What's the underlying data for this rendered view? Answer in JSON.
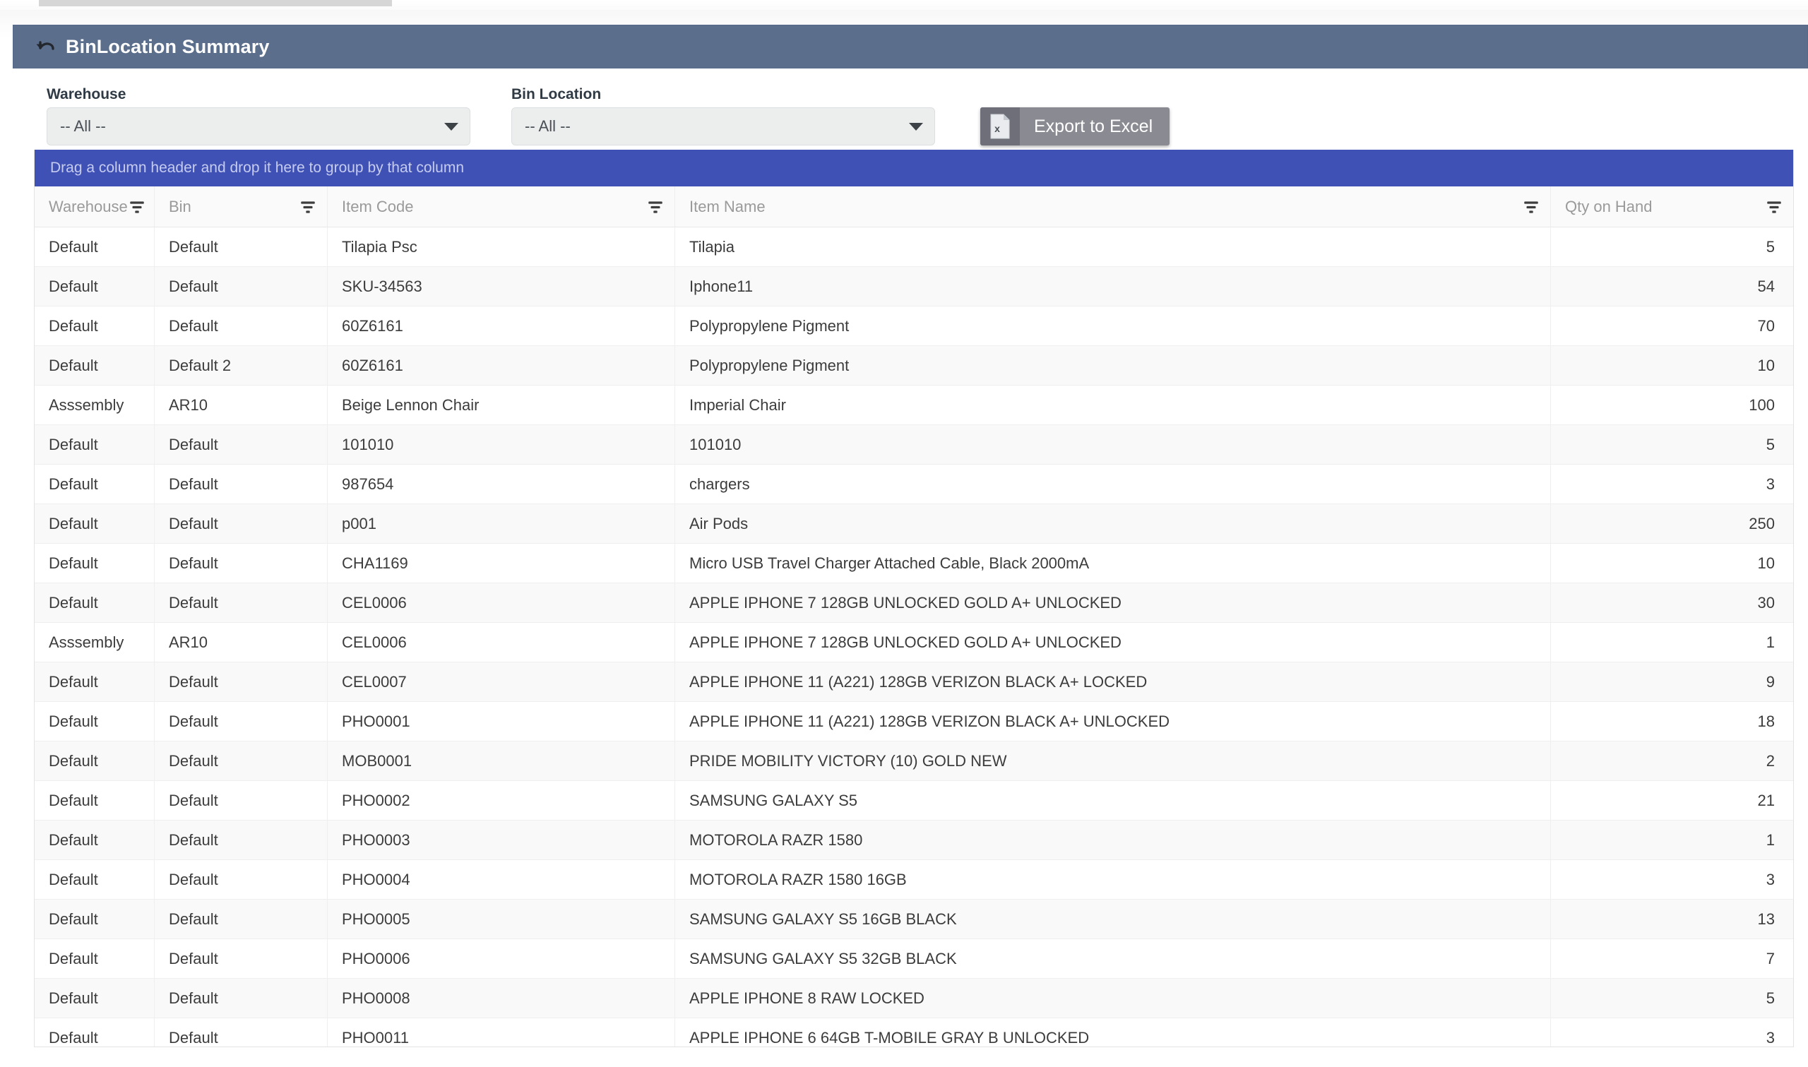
{
  "window": {
    "title": "BinLocation Summary",
    "back_icon": "undo-arrow-icon",
    "header_color": "#5b6e8c"
  },
  "filters": {
    "warehouse": {
      "label": "Warehouse",
      "value": "-- All --",
      "caret_icon": "chevron-down-icon"
    },
    "bin_location": {
      "label": "Bin Location",
      "value": "-- All --",
      "caret_icon": "chevron-down-icon"
    },
    "export_button": {
      "label": "Export to Excel",
      "icon": "excel-file-icon",
      "icon_glyph": "x",
      "color": "#8a8a93"
    }
  },
  "grid": {
    "group_panel_text": "Drag a column header and drop it here to group by that column",
    "group_panel_color": "#3f51b5",
    "filter_icon": "filter-icon",
    "columns": [
      {
        "key": "warehouse",
        "label": "Warehouse",
        "align": "left"
      },
      {
        "key": "bin",
        "label": "Bin",
        "align": "left"
      },
      {
        "key": "item_code",
        "label": "Item Code",
        "align": "left"
      },
      {
        "key": "item_name",
        "label": "Item Name",
        "align": "left"
      },
      {
        "key": "qty_on_hand",
        "label": "Qty on Hand",
        "align": "right"
      }
    ],
    "rows": [
      {
        "warehouse": "Default",
        "bin": "Default",
        "item_code": "Tilapia Psc",
        "item_name": "Tilapia",
        "qty_on_hand": "5"
      },
      {
        "warehouse": "Default",
        "bin": "Default",
        "item_code": "SKU-34563",
        "item_name": "Iphone11",
        "qty_on_hand": "54"
      },
      {
        "warehouse": "Default",
        "bin": "Default",
        "item_code": "60Z6161",
        "item_name": "Polypropylene Pigment",
        "qty_on_hand": "70"
      },
      {
        "warehouse": "Default",
        "bin": "Default 2",
        "item_code": "60Z6161",
        "item_name": "Polypropylene Pigment",
        "qty_on_hand": "10"
      },
      {
        "warehouse": "Asssembly",
        "bin": "AR10",
        "item_code": "Beige Lennon Chair",
        "item_name": "Imperial Chair",
        "qty_on_hand": "100"
      },
      {
        "warehouse": "Default",
        "bin": "Default",
        "item_code": "101010",
        "item_name": "101010",
        "qty_on_hand": "5"
      },
      {
        "warehouse": "Default",
        "bin": "Default",
        "item_code": "987654",
        "item_name": "chargers",
        "qty_on_hand": "3"
      },
      {
        "warehouse": "Default",
        "bin": "Default",
        "item_code": "p001",
        "item_name": "Air Pods",
        "qty_on_hand": "250"
      },
      {
        "warehouse": "Default",
        "bin": "Default",
        "item_code": "CHA1169",
        "item_name": "Micro USB Travel Charger Attached Cable, Black 2000mA",
        "qty_on_hand": "10"
      },
      {
        "warehouse": "Default",
        "bin": "Default",
        "item_code": "CEL0006",
        "item_name": "APPLE IPHONE 7 128GB UNLOCKED GOLD A+ UNLOCKED",
        "qty_on_hand": "30"
      },
      {
        "warehouse": "Asssembly",
        "bin": "AR10",
        "item_code": "CEL0006",
        "item_name": "APPLE IPHONE 7 128GB UNLOCKED GOLD A+ UNLOCKED",
        "qty_on_hand": "1"
      },
      {
        "warehouse": "Default",
        "bin": "Default",
        "item_code": "CEL0007",
        "item_name": "APPLE IPHONE 11 (A221) 128GB VERIZON BLACK A+ LOCKED",
        "qty_on_hand": "9"
      },
      {
        "warehouse": "Default",
        "bin": "Default",
        "item_code": "PHO0001",
        "item_name": "APPLE IPHONE 11 (A221) 128GB VERIZON BLACK A+ UNLOCKED",
        "qty_on_hand": "18"
      },
      {
        "warehouse": "Default",
        "bin": "Default",
        "item_code": "MOB0001",
        "item_name": "PRIDE MOBILITY VICTORY (10) GOLD NEW",
        "qty_on_hand": "2"
      },
      {
        "warehouse": "Default",
        "bin": "Default",
        "item_code": "PHO0002",
        "item_name": "SAMSUNG GALAXY S5",
        "qty_on_hand": "21"
      },
      {
        "warehouse": "Default",
        "bin": "Default",
        "item_code": "PHO0003",
        "item_name": "MOTOROLA RAZR 1580",
        "qty_on_hand": "1"
      },
      {
        "warehouse": "Default",
        "bin": "Default",
        "item_code": "PHO0004",
        "item_name": "MOTOROLA RAZR 1580 16GB",
        "qty_on_hand": "3"
      },
      {
        "warehouse": "Default",
        "bin": "Default",
        "item_code": "PHO0005",
        "item_name": "SAMSUNG GALAXY S5 16GB BLACK",
        "qty_on_hand": "13"
      },
      {
        "warehouse": "Default",
        "bin": "Default",
        "item_code": "PHO0006",
        "item_name": "SAMSUNG GALAXY S5 32GB BLACK",
        "qty_on_hand": "7"
      },
      {
        "warehouse": "Default",
        "bin": "Default",
        "item_code": "PHO0008",
        "item_name": "APPLE IPHONE 8 RAW LOCKED",
        "qty_on_hand": "5"
      },
      {
        "warehouse": "Default",
        "bin": "Default",
        "item_code": "PHO0011",
        "item_name": "APPLE IPHONE 6 64GB T-MOBILE GRAY B UNLOCKED",
        "qty_on_hand": "3"
      }
    ]
  }
}
